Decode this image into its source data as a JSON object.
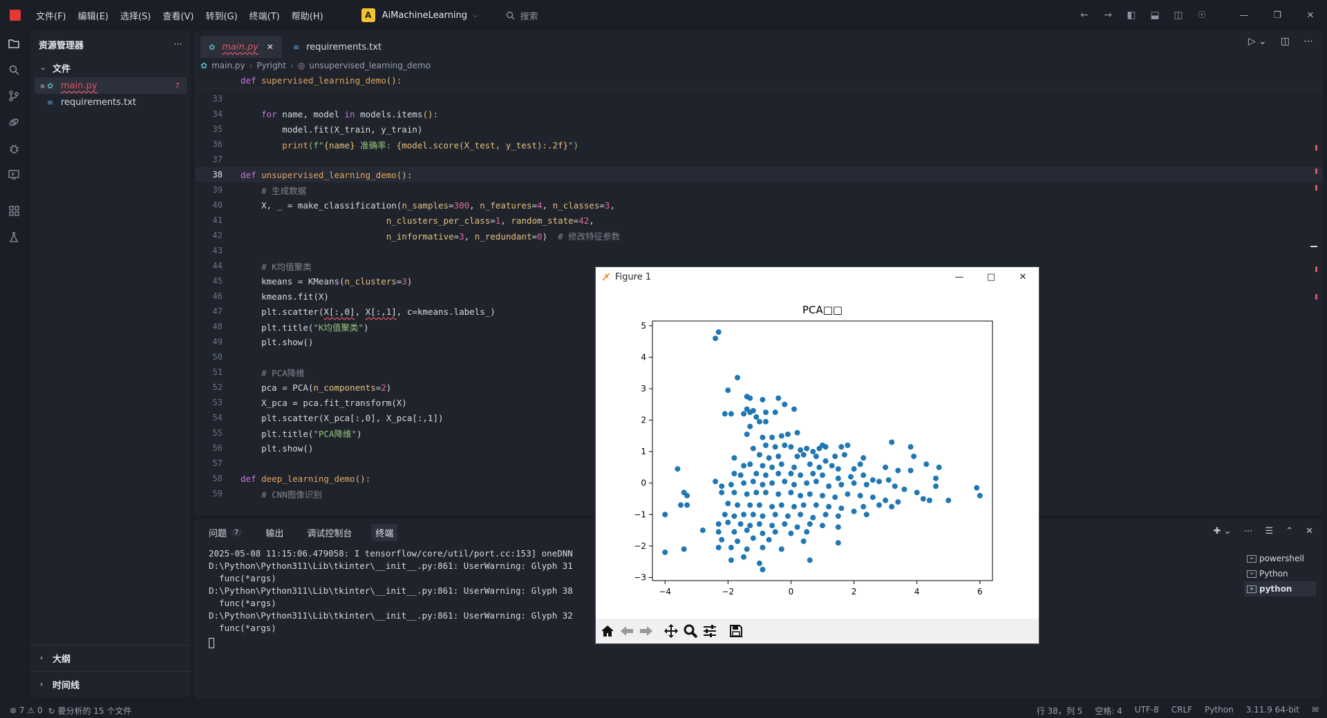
{
  "menu": [
    "文件(F)",
    "编辑(E)",
    "选择(S)",
    "查看(V)",
    "转到(G)",
    "终端(T)",
    "帮助(H)"
  ],
  "project": {
    "badge": "A",
    "name": "AiMachineLearning"
  },
  "search": {
    "label": "搜索"
  },
  "explorer": {
    "title": "资源管理器",
    "section_files": "文件",
    "files": [
      {
        "name": "main.py",
        "badge": "7"
      },
      {
        "name": "requirements.txt"
      }
    ],
    "section_outline": "大纲",
    "section_timeline": "时间线"
  },
  "tabs": [
    {
      "label": "main.py"
    },
    {
      "label": "requirements.txt"
    }
  ],
  "breadcrumb": {
    "file": "main.py",
    "lang": "Pyright",
    "symbol": "unsupervised_learning_demo"
  },
  "code": {
    "sticky": "def supervised_learning_demo():",
    "lines": [
      {
        "n": "33"
      },
      {
        "n": "34"
      },
      {
        "n": "35"
      },
      {
        "n": "36"
      },
      {
        "n": "37"
      },
      {
        "n": "38"
      },
      {
        "n": "39"
      },
      {
        "n": "40"
      },
      {
        "n": "41"
      },
      {
        "n": "42"
      },
      {
        "n": "43"
      },
      {
        "n": "44"
      },
      {
        "n": "45"
      },
      {
        "n": "46"
      },
      {
        "n": "47"
      },
      {
        "n": "48"
      },
      {
        "n": "49"
      },
      {
        "n": "50"
      },
      {
        "n": "51"
      },
      {
        "n": "52"
      },
      {
        "n": "53"
      },
      {
        "n": "54"
      },
      {
        "n": "55"
      },
      {
        "n": "56"
      },
      {
        "n": "57"
      },
      {
        "n": "58"
      },
      {
        "n": "59"
      }
    ],
    "t34a": "for",
    "t34b": " name, model ",
    "t34c": "in",
    "t34d": " models.items",
    "t35": "model.fit(X_train, y_train)",
    "t36a": "print",
    "t36b": "(f\"",
    "t36c": "{name}",
    "t36d": " 准确率: ",
    "t36e": "{model.score(X_test, y_test):.2f}",
    "t36f": "\")",
    "t38a": "def",
    "t38b": "unsupervised_learning_demo",
    "t39": "# 生成数据",
    "t40a": "X, _ = make_classification(",
    "t40b": "n_samples",
    "t40c": "300",
    "t40d": "n_features",
    "t40e": "4",
    "t40f": "n_classes",
    "t40g": "3",
    "t41a": "n_clusters_per_class",
    "t41b": "1",
    "t41c": "random_state",
    "t41d": "42",
    "t42a": "n_informative",
    "t42b": "3",
    "t42c": "n_redundant",
    "t42d": "0",
    "t42e": "# 修改特征参数",
    "t44": "# K均值聚类",
    "t45a": "kmeans = KMeans(",
    "t45b": "n_clusters",
    "t45c": "3",
    "t46": "kmeans.fit(X)",
    "t47a": "plt.scatter(",
    "t47b": "X[:,0]",
    "t47c": ", ",
    "t47d": "X[:,1]",
    "t47e": ", c=kmeans.labels_)",
    "t48a": "plt.title(",
    "t48b": "\"K均值聚类\"",
    "t48c": ")",
    "t49": "plt.show()",
    "t51": "# PCA降维",
    "t52a": "pca = PCA(",
    "t52b": "n_components",
    "t52c": "2",
    "t53": "X_pca = pca.fit_transform(X)",
    "t54": "plt.scatter(X_pca[:,0], X_pca[:,1])",
    "t55a": "plt.title(",
    "t55b": "\"PCA降维\"",
    "t55c": ")",
    "t56": "plt.show()",
    "t58a": "def",
    "t58b": "deep_learning_demo",
    "t59": "# CNN图像识别"
  },
  "panel": {
    "tabs": [
      {
        "label": "问题",
        "badge": "7"
      },
      {
        "label": "输出"
      },
      {
        "label": "调试控制台"
      },
      {
        "label": "终端"
      }
    ],
    "terminal_lines": [
      "2025-05-08 11:15:06.479058: I tensorflow/core/util/port.cc:153] oneDNN",
      "D:\\Python\\Python311\\Lib\\tkinter\\__init__.py:861: UserWarning: Glyph 31",
      "  func(*args)",
      "D:\\Python\\Python311\\Lib\\tkinter\\__init__.py:861: UserWarning: Glyph 38",
      "  func(*args)",
      "D:\\Python\\Python311\\Lib\\tkinter\\__init__.py:861: UserWarning: Glyph 32",
      "  func(*args)"
    ],
    "terminals": [
      "powershell",
      "Python",
      "python"
    ]
  },
  "status": {
    "errors": "7",
    "warnings": "0",
    "analysis": "要分析的 15 个文件",
    "position": "行 38，列 5",
    "spaces": "空格: 4",
    "encoding": "UTF-8",
    "eol": "CRLF",
    "language": "Python",
    "interpreter": "3.11.9 64-bit"
  },
  "figure": {
    "window_title": "Figure 1",
    "chart_data": {
      "type": "scatter",
      "title": "PCA□□",
      "xlabel": "",
      "ylabel": "",
      "xlim": [
        -4.4,
        6.4
      ],
      "ylim": [
        -3.1,
        5.15
      ],
      "xticks": [
        "−4",
        "−2",
        "0",
        "2",
        "4",
        "6"
      ],
      "yticks": [
        "−3",
        "−2",
        "−1",
        "0",
        "1",
        "2",
        "3",
        "4",
        "5"
      ],
      "color": "#1f77b4",
      "points": [
        [
          -2.3,
          4.8
        ],
        [
          -2.4,
          4.6
        ],
        [
          -1.7,
          3.35
        ],
        [
          -2.0,
          2.95
        ],
        [
          -1.4,
          2.75
        ],
        [
          -1.3,
          2.7
        ],
        [
          -0.9,
          2.65
        ],
        [
          -0.4,
          2.7
        ],
        [
          -0.2,
          2.5
        ],
        [
          0.1,
          2.35
        ],
        [
          -1.4,
          2.35
        ],
        [
          -1.5,
          2.2
        ],
        [
          -1.3,
          2.25
        ],
        [
          -1.2,
          2.3
        ],
        [
          -0.8,
          2.25
        ],
        [
          -0.5,
          2.25
        ],
        [
          -2.1,
          2.2
        ],
        [
          -1.9,
          2.2
        ],
        [
          -1.1,
          2.1
        ],
        [
          -1.0,
          1.95
        ],
        [
          -0.8,
          1.95
        ],
        [
          -1.3,
          1.8
        ],
        [
          -1.4,
          1.55
        ],
        [
          -0.9,
          1.45
        ],
        [
          -0.6,
          1.45
        ],
        [
          -0.3,
          1.5
        ],
        [
          -0.1,
          1.55
        ],
        [
          0.2,
          1.6
        ],
        [
          -1.2,
          1.1
        ],
        [
          -0.8,
          1.2
        ],
        [
          -0.5,
          1.15
        ],
        [
          -0.2,
          1.2
        ],
        [
          0.0,
          1.15
        ],
        [
          0.3,
          1.05
        ],
        [
          0.5,
          1.1
        ],
        [
          0.7,
          1.0
        ],
        [
          0.9,
          1.1
        ],
        [
          1.0,
          1.2
        ],
        [
          1.1,
          1.15
        ],
        [
          1.6,
          1.15
        ],
        [
          1.8,
          1.2
        ],
        [
          3.2,
          1.3
        ],
        [
          3.8,
          1.15
        ],
        [
          -1.8,
          0.8
        ],
        [
          -1.0,
          0.9
        ],
        [
          -0.7,
          0.8
        ],
        [
          -0.4,
          0.85
        ],
        [
          0.2,
          0.85
        ],
        [
          0.4,
          0.9
        ],
        [
          0.8,
          0.85
        ],
        [
          1.1,
          0.7
        ],
        [
          1.4,
          0.85
        ],
        [
          1.7,
          0.9
        ],
        [
          2.3,
          0.8
        ],
        [
          3.9,
          0.85
        ],
        [
          4.3,
          0.6
        ],
        [
          4.7,
          0.5
        ],
        [
          -3.6,
          0.45
        ],
        [
          -1.5,
          0.55
        ],
        [
          -1.3,
          0.6
        ],
        [
          -0.9,
          0.55
        ],
        [
          -0.6,
          0.5
        ],
        [
          -0.3,
          0.6
        ],
        [
          0.1,
          0.5
        ],
        [
          0.6,
          0.6
        ],
        [
          0.9,
          0.5
        ],
        [
          1.3,
          0.55
        ],
        [
          1.5,
          0.45
        ],
        [
          2.0,
          0.45
        ],
        [
          2.2,
          0.6
        ],
        [
          3.0,
          0.5
        ],
        [
          3.4,
          0.4
        ],
        [
          -1.8,
          0.3
        ],
        [
          -1.6,
          0.25
        ],
        [
          -1.1,
          0.3
        ],
        [
          -0.8,
          0.25
        ],
        [
          -0.4,
          0.3
        ],
        [
          0.0,
          0.3
        ],
        [
          0.3,
          0.25
        ],
        [
          0.7,
          0.3
        ],
        [
          1.0,
          0.25
        ],
        [
          1.5,
          0.15
        ],
        [
          1.9,
          0.2
        ],
        [
          2.3,
          0.25
        ],
        [
          2.6,
          0.1
        ],
        [
          3.1,
          0.1
        ],
        [
          3.8,
          0.4
        ],
        [
          4.6,
          -0.1
        ],
        [
          4.6,
          0.15
        ],
        [
          5.9,
          -0.15
        ],
        [
          6.0,
          -0.4
        ],
        [
          -2.4,
          0.05
        ],
        [
          -2.2,
          -0.1
        ],
        [
          -1.9,
          -0.05
        ],
        [
          -1.5,
          0.0
        ],
        [
          -1.2,
          0.05
        ],
        [
          -0.9,
          -0.05
        ],
        [
          -0.6,
          0.0
        ],
        [
          -0.2,
          0.05
        ],
        [
          0.1,
          -0.05
        ],
        [
          0.5,
          0.0
        ],
        [
          0.8,
          0.05
        ],
        [
          1.2,
          -0.1
        ],
        [
          1.6,
          -0.05
        ],
        [
          2.0,
          0.0
        ],
        [
          2.4,
          -0.05
        ],
        [
          2.8,
          0.05
        ],
        [
          3.3,
          -0.1
        ],
        [
          3.6,
          -0.2
        ],
        [
          4.0,
          -0.3
        ],
        [
          -3.4,
          -0.3
        ],
        [
          -3.3,
          -0.4
        ],
        [
          -2.2,
          -0.3
        ],
        [
          -1.8,
          -0.3
        ],
        [
          -1.4,
          -0.35
        ],
        [
          -1.1,
          -0.3
        ],
        [
          -0.8,
          -0.3
        ],
        [
          -0.4,
          -0.35
        ],
        [
          0.0,
          -0.3
        ],
        [
          0.3,
          -0.4
        ],
        [
          0.6,
          -0.35
        ],
        [
          1.0,
          -0.4
        ],
        [
          1.4,
          -0.45
        ],
        [
          1.8,
          -0.35
        ],
        [
          2.2,
          -0.4
        ],
        [
          2.6,
          -0.45
        ],
        [
          3.0,
          -0.55
        ],
        [
          3.4,
          -0.6
        ],
        [
          4.2,
          -0.5
        ],
        [
          4.4,
          -0.55
        ],
        [
          5.0,
          -0.55
        ],
        [
          -3.5,
          -0.7
        ],
        [
          -3.3,
          -0.7
        ],
        [
          -2.0,
          -0.65
        ],
        [
          -1.7,
          -0.7
        ],
        [
          -1.3,
          -0.7
        ],
        [
          -1.0,
          -0.7
        ],
        [
          -0.6,
          -0.75
        ],
        [
          -0.3,
          -0.7
        ],
        [
          0.1,
          -0.75
        ],
        [
          0.4,
          -0.7
        ],
        [
          0.8,
          -0.7
        ],
        [
          1.2,
          -0.75
        ],
        [
          1.6,
          -0.8
        ],
        [
          2.0,
          -0.9
        ],
        [
          2.3,
          -0.75
        ],
        [
          2.8,
          -0.7
        ],
        [
          3.2,
          -0.75
        ],
        [
          -4.0,
          -1.0
        ],
        [
          -2.1,
          -1.0
        ],
        [
          -1.8,
          -1.05
        ],
        [
          -1.5,
          -1.0
        ],
        [
          -1.2,
          -1.0
        ],
        [
          -0.9,
          -1.05
        ],
        [
          -0.5,
          -1.0
        ],
        [
          -0.1,
          -1.05
        ],
        [
          0.3,
          -1.0
        ],
        [
          0.7,
          -1.1
        ],
        [
          1.1,
          -1.0
        ],
        [
          1.5,
          -1.05
        ],
        [
          2.4,
          -1.0
        ],
        [
          -2.3,
          -1.3
        ],
        [
          -2.0,
          -1.25
        ],
        [
          -1.6,
          -1.3
        ],
        [
          -1.3,
          -1.35
        ],
        [
          -1.0,
          -1.3
        ],
        [
          -0.6,
          -1.35
        ],
        [
          -0.2,
          -1.3
        ],
        [
          0.2,
          -1.4
        ],
        [
          0.6,
          -1.3
        ],
        [
          1.0,
          -1.35
        ],
        [
          1.5,
          -1.4
        ],
        [
          -2.8,
          -1.5
        ],
        [
          -2.3,
          -1.55
        ],
        [
          -1.8,
          -1.55
        ],
        [
          -1.4,
          -1.5
        ],
        [
          -0.9,
          -1.6
        ],
        [
          -0.5,
          -1.55
        ],
        [
          0.0,
          -1.6
        ],
        [
          0.5,
          -1.55
        ],
        [
          -2.2,
          -1.8
        ],
        [
          -1.7,
          -1.85
        ],
        [
          -1.2,
          -1.75
        ],
        [
          -0.7,
          -1.8
        ],
        [
          0.4,
          -1.85
        ],
        [
          1.5,
          -1.9
        ],
        [
          -3.4,
          -2.1
        ],
        [
          -2.3,
          -2.05
        ],
        [
          -1.9,
          -2.05
        ],
        [
          -1.4,
          -2.1
        ],
        [
          -0.9,
          -2.05
        ],
        [
          -0.3,
          -2.1
        ],
        [
          -4.0,
          -2.2
        ],
        [
          -1.5,
          -2.35
        ],
        [
          -1.9,
          -2.45
        ],
        [
          -1.0,
          -2.55
        ],
        [
          0.6,
          -2.45
        ],
        [
          -0.9,
          -2.75
        ]
      ]
    }
  }
}
